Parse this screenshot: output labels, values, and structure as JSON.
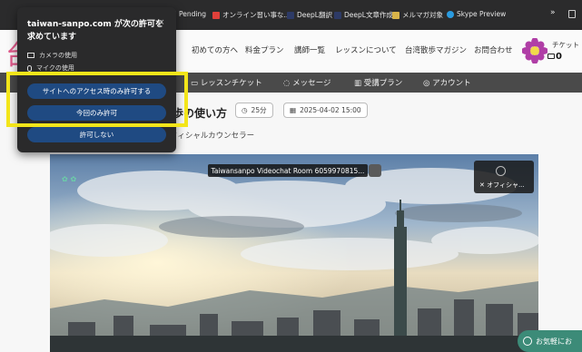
{
  "bookmarks": [
    {
      "label": "Pending",
      "color": "#666666"
    },
    {
      "label": "オンライン習い事な...",
      "color": "#e0403a"
    },
    {
      "label": "DeepL翻訳",
      "color": "#2d3a66"
    },
    {
      "label": "DeepL文章作成",
      "color": "#2d3a66"
    },
    {
      "label": "メルマガ対象",
      "color": "#d9b44a"
    },
    {
      "label": "Skype Preview",
      "color": "#2a9be0"
    }
  ],
  "bookmarks_more": "»",
  "header": {
    "logo_char": "台",
    "nav": [
      "初めての方へ",
      "料金プラン",
      "講師一覧",
      "レッスンについて",
      "台湾散歩マガジン",
      "お問合わせ"
    ],
    "ticket_label": "チケット",
    "ticket_count": "0"
  },
  "menu": [
    "レッスンチケット",
    "メッセージ",
    "受講プラン",
    "アカウント"
  ],
  "content": {
    "title": "歩の使い方",
    "duration": "25分",
    "datetime": "2025-04-02 15:00",
    "counselor": "フィシャルカウンセラー"
  },
  "video": {
    "room_label": "Taiwansanpo Videochat Room 6059970815...",
    "self_label": "オフィシャ..."
  },
  "chat_button": "お気軽にお",
  "permission": {
    "title": "taiwan-sanpo.com が次の許可を求めています",
    "close": "×",
    "camera": "カメラの使用",
    "mic": "マイクの使用",
    "buttons": [
      "サイトへのアクセス時のみ許可する",
      "今回のみ許可",
      "許可しない"
    ]
  },
  "colors": {
    "accent": "#f3e51a",
    "perm_button": "#1f4a82",
    "menu_bar": "#4a4a4a"
  }
}
